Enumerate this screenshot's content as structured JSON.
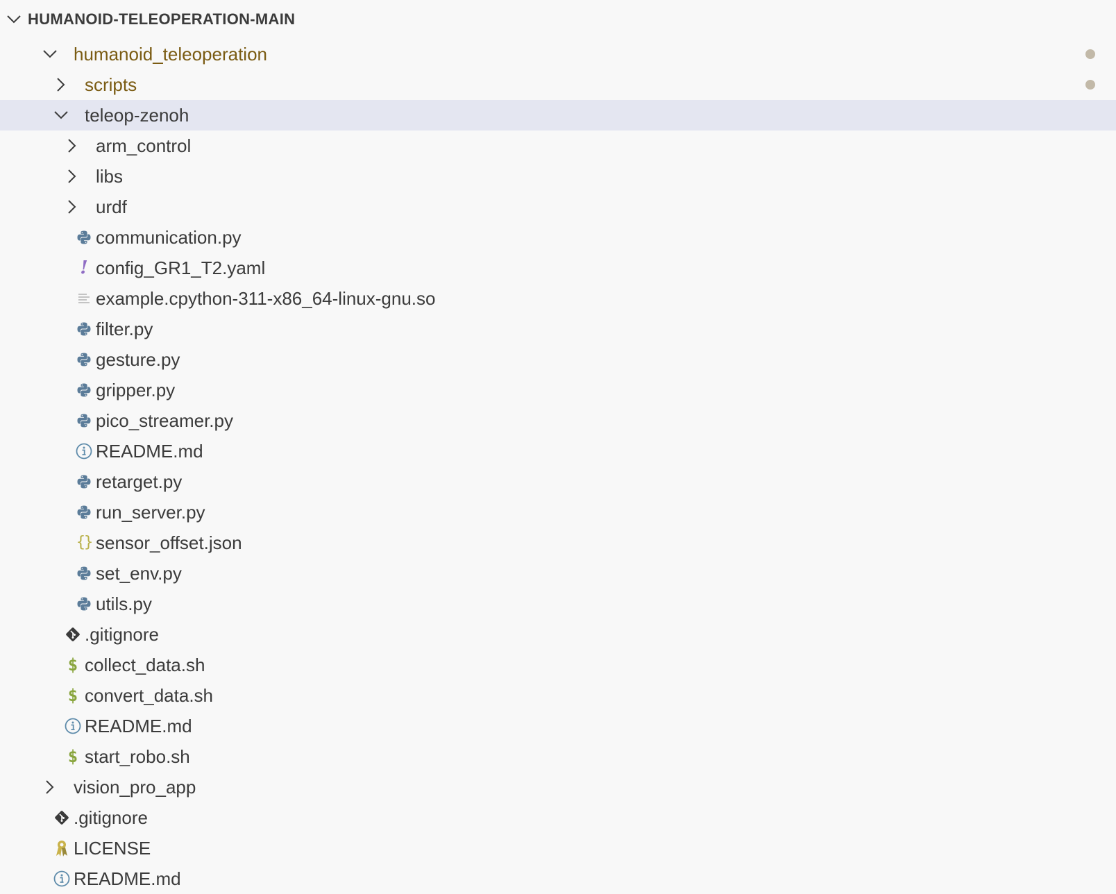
{
  "explorer": {
    "root_label": "HUMANOID-TELEOPERATION-MAIN",
    "items": [
      {
        "label": "humanoid_teleoperation",
        "kind": "folder-open",
        "depth": 1,
        "modified": true
      },
      {
        "label": "scripts",
        "kind": "folder-closed",
        "depth": 2,
        "modified": true
      },
      {
        "label": "teleop-zenoh",
        "kind": "folder-open",
        "depth": 2,
        "selected": true
      },
      {
        "label": "arm_control",
        "kind": "folder-closed",
        "depth": 3
      },
      {
        "label": "libs",
        "kind": "folder-closed",
        "depth": 3
      },
      {
        "label": "urdf",
        "kind": "folder-closed",
        "depth": 3
      },
      {
        "label": "communication.py",
        "kind": "python",
        "depth": 3
      },
      {
        "label": "config_GR1_T2.yaml",
        "kind": "yaml",
        "depth": 3
      },
      {
        "label": "example.cpython-311-x86_64-linux-gnu.so",
        "kind": "binary",
        "depth": 3
      },
      {
        "label": "filter.py",
        "kind": "python",
        "depth": 3
      },
      {
        "label": "gesture.py",
        "kind": "python",
        "depth": 3
      },
      {
        "label": "gripper.py",
        "kind": "python",
        "depth": 3
      },
      {
        "label": "pico_streamer.py",
        "kind": "python",
        "depth": 3
      },
      {
        "label": "README.md",
        "kind": "info",
        "depth": 3
      },
      {
        "label": "retarget.py",
        "kind": "python",
        "depth": 3
      },
      {
        "label": "run_server.py",
        "kind": "python",
        "depth": 3
      },
      {
        "label": "sensor_offset.json",
        "kind": "json",
        "depth": 3
      },
      {
        "label": "set_env.py",
        "kind": "python",
        "depth": 3
      },
      {
        "label": "utils.py",
        "kind": "python",
        "depth": 3
      },
      {
        "label": ".gitignore",
        "kind": "git",
        "depth": 2
      },
      {
        "label": "collect_data.sh",
        "kind": "shell",
        "depth": 2
      },
      {
        "label": "convert_data.sh",
        "kind": "shell",
        "depth": 2
      },
      {
        "label": "README.md",
        "kind": "info",
        "depth": 2
      },
      {
        "label": "start_robo.sh",
        "kind": "shell",
        "depth": 2
      },
      {
        "label": "vision_pro_app",
        "kind": "folder-closed",
        "depth": 1
      },
      {
        "label": ".gitignore",
        "kind": "git",
        "depth": 1
      },
      {
        "label": "LICENSE",
        "kind": "license",
        "depth": 1
      },
      {
        "label": "README.md",
        "kind": "info",
        "depth": 1
      }
    ]
  },
  "icons": {
    "folder-open": "chevron-down-icon",
    "folder-closed": "chevron-right-icon",
    "python": "python-icon",
    "yaml": "yaml-icon",
    "binary": "file-lines-icon",
    "info": "info-icon",
    "json": "json-braces-icon",
    "git": "git-icon",
    "shell": "shell-dollar-icon",
    "license": "license-icon"
  },
  "colors": {
    "background": "#f8f8f8",
    "selected_row": "#e4e6f1",
    "text": "#3b3b3b",
    "modified_text": "#7a5b12",
    "modified_dot": "#c2b9a8",
    "python": "#5b7c99",
    "info": "#5f8cab",
    "shell": "#89a53d",
    "yaml": "#8f6cc4",
    "json": "#b9b14a",
    "license": "#c9b24a",
    "binary": "#b8b8b8",
    "git": "#3b3b3b"
  }
}
